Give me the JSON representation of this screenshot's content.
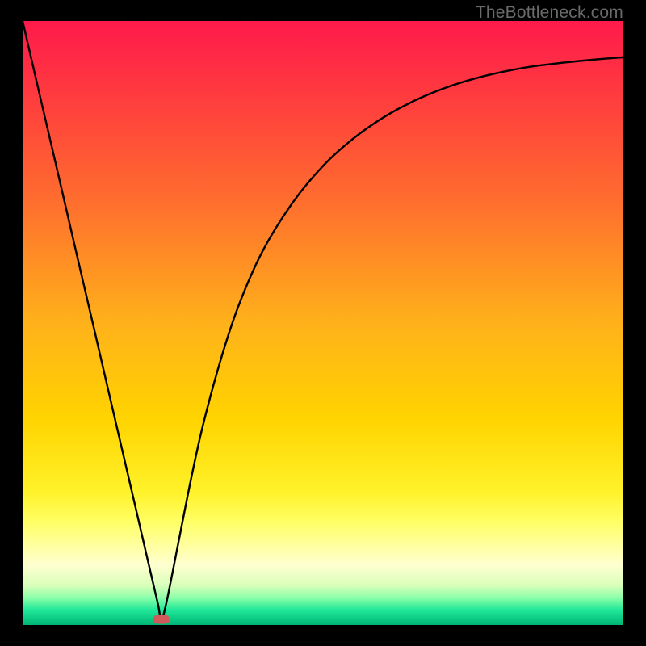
{
  "watermark": "TheBottleneck.com",
  "chart_data": {
    "type": "line",
    "title": "",
    "xlabel": "",
    "ylabel": "",
    "xlim": [
      0,
      100
    ],
    "ylim": [
      0,
      100
    ],
    "grid": false,
    "legend": false,
    "gradient_stops": [
      {
        "offset": 0.0,
        "color": "#ff1a4b"
      },
      {
        "offset": 0.12,
        "color": "#ff3a3f"
      },
      {
        "offset": 0.3,
        "color": "#ff6e2e"
      },
      {
        "offset": 0.5,
        "color": "#ffb11a"
      },
      {
        "offset": 0.66,
        "color": "#ffd400"
      },
      {
        "offset": 0.78,
        "color": "#fff22a"
      },
      {
        "offset": 0.83,
        "color": "#ffff66"
      },
      {
        "offset": 0.9,
        "color": "#ffffd0"
      },
      {
        "offset": 0.935,
        "color": "#d8ffba"
      },
      {
        "offset": 0.955,
        "color": "#8affa8"
      },
      {
        "offset": 0.975,
        "color": "#20e89a"
      },
      {
        "offset": 1.0,
        "color": "#00b574"
      }
    ],
    "marker": {
      "x": 23.1,
      "y": 1.0,
      "color": "#d05a5a"
    },
    "series": [
      {
        "name": "curve",
        "x": [
          0.0,
          3.0,
          6.0,
          9.0,
          12.0,
          15.0,
          18.0,
          21.0,
          22.5,
          23.1,
          24.0,
          26.0,
          28.0,
          30.0,
          33.0,
          36.0,
          40.0,
          45.0,
          50.0,
          55.0,
          60.0,
          65.0,
          70.0,
          75.0,
          80.0,
          85.0,
          90.0,
          95.0,
          100.0
        ],
        "y": [
          100.0,
          87.1,
          74.3,
          61.4,
          48.6,
          35.7,
          22.9,
          10.0,
          3.6,
          1.0,
          4.0,
          14.0,
          24.0,
          33.0,
          44.0,
          53.0,
          62.0,
          70.0,
          76.0,
          80.5,
          84.0,
          86.7,
          88.8,
          90.4,
          91.6,
          92.5,
          93.1,
          93.6,
          94.0
        ]
      }
    ]
  }
}
